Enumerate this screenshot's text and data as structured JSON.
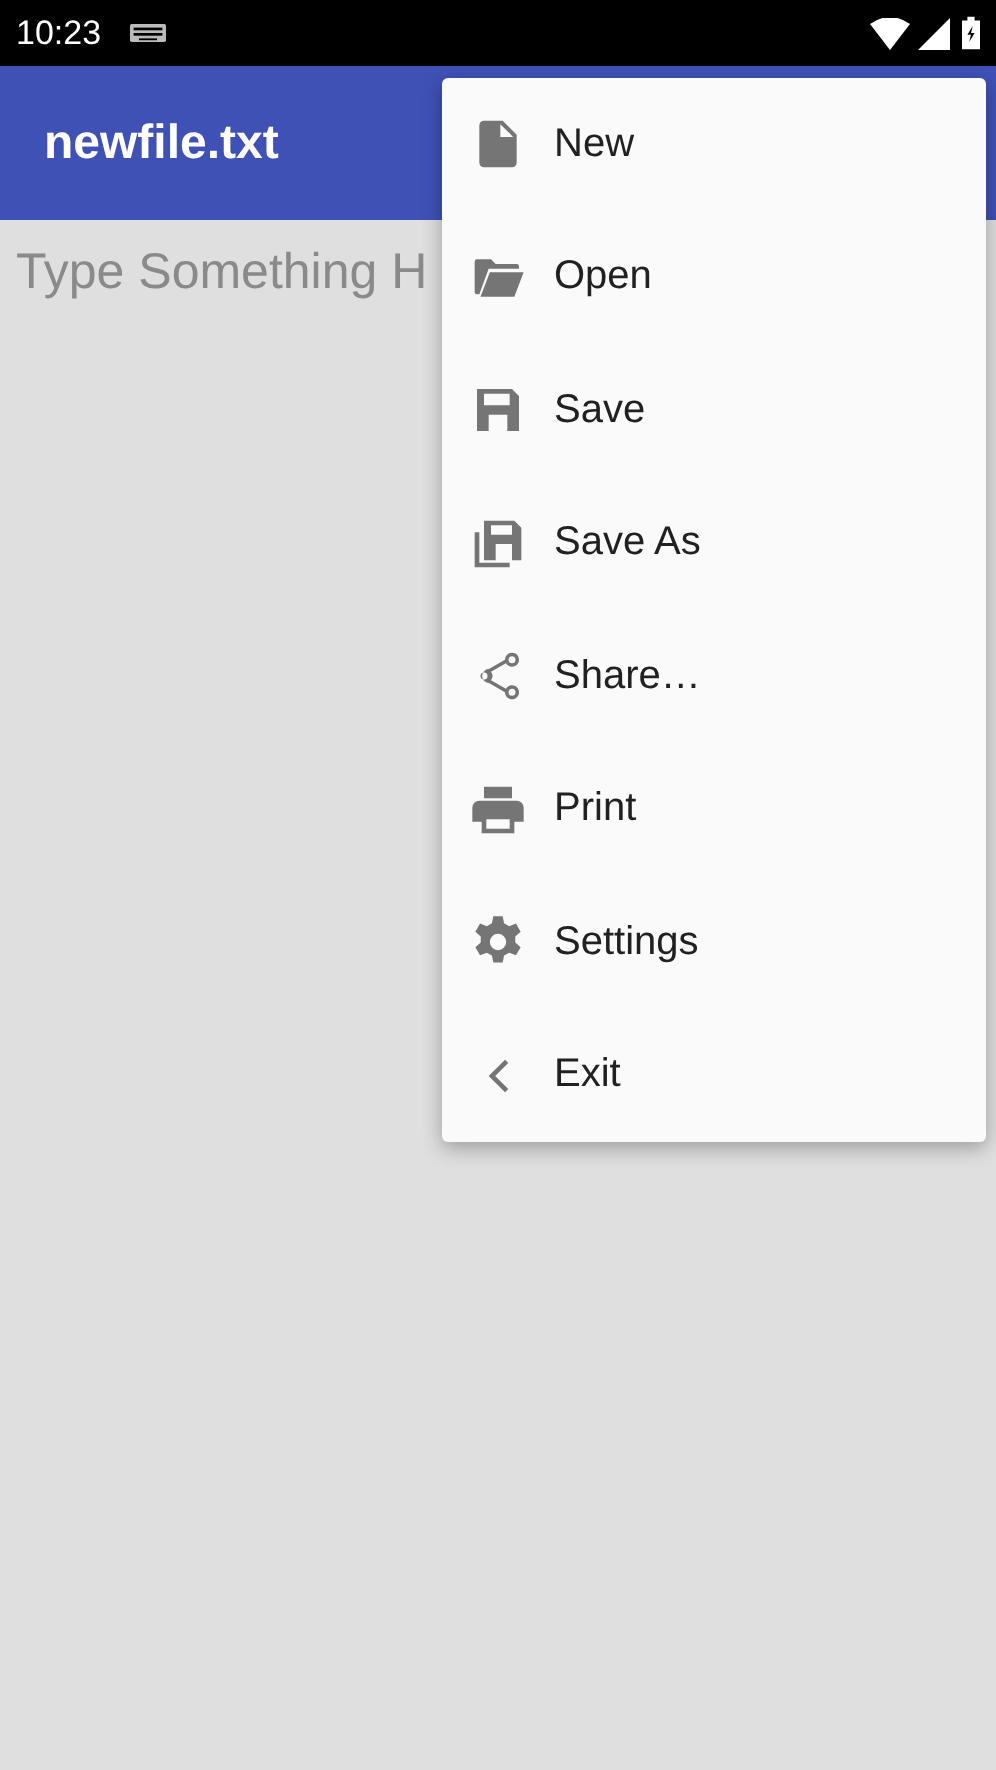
{
  "status_bar": {
    "time": "10:23"
  },
  "app_bar": {
    "title": "newfile.txt"
  },
  "editor": {
    "placeholder": "Type Something H"
  },
  "menu": {
    "items": [
      {
        "label": "New"
      },
      {
        "label": "Open"
      },
      {
        "label": "Save"
      },
      {
        "label": "Save As"
      },
      {
        "label": "Share…"
      },
      {
        "label": "Print"
      },
      {
        "label": "Settings"
      },
      {
        "label": "Exit"
      }
    ]
  }
}
